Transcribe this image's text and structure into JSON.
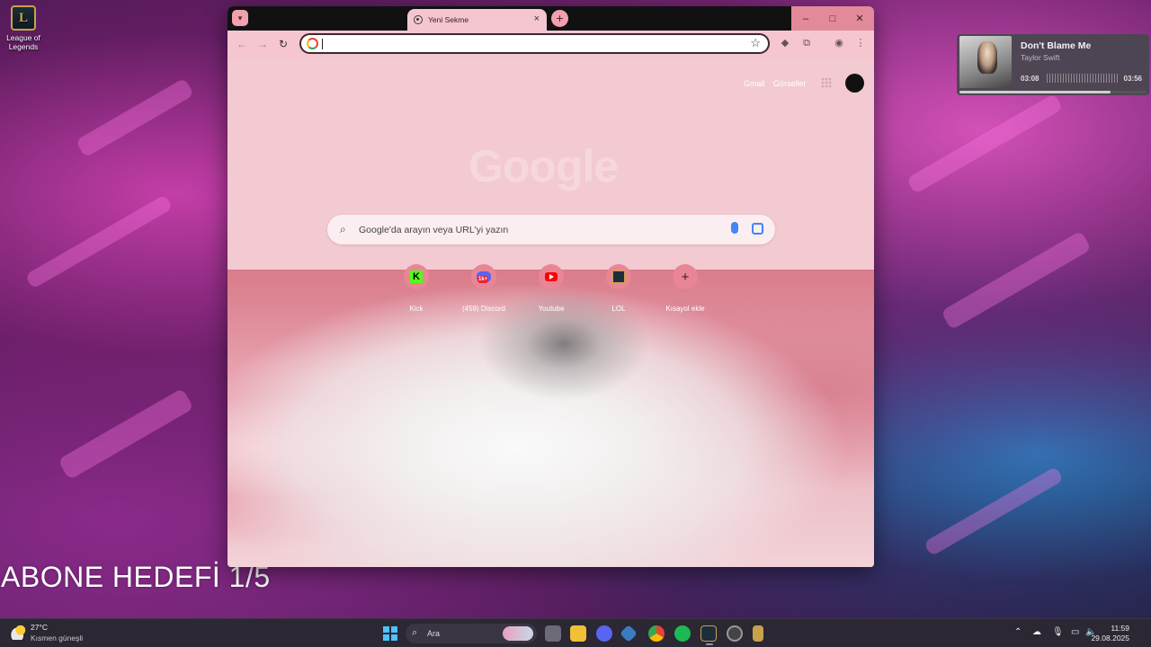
{
  "desktop": {
    "icon_label": "League of Legends",
    "overlay_text": "ABONE HEDEFİ 1/5"
  },
  "music_widget": {
    "title": "Don't Blame Me",
    "artist": "Taylor Swift",
    "elapsed": "03:08",
    "duration": "03:56",
    "progress_fraction": 0.81
  },
  "browser": {
    "tab_title": "Yeni Sekme",
    "tab_close": "×",
    "new_tab": "+",
    "window_controls": {
      "minimize": "–",
      "maximize": "□",
      "close": "✕"
    },
    "nav": {
      "back": "←",
      "forward": "→",
      "reload": "↻"
    },
    "omnibox_value": "",
    "bookmark_star": "☆",
    "top_links": {
      "gmail": "Gmail",
      "images": "Görseller"
    },
    "logo_text": "Google",
    "search_placeholder": "Google'da arayın veya URL'yi yazın",
    "shortcuts": [
      {
        "label": "Kick",
        "icon": "kick-icon"
      },
      {
        "label": "(459) Discord",
        "icon": "discord-icon"
      },
      {
        "label": "Youtube",
        "icon": "youtube-icon"
      },
      {
        "label": "LOL",
        "icon": "league-icon"
      },
      {
        "label": "Kısayol ekle",
        "icon": "plus-icon"
      }
    ],
    "accent_color": "#f4c9d0"
  },
  "taskbar": {
    "weather_temp": "27°C",
    "weather_desc": "Kısmen güneşli",
    "search_label": "Ara",
    "search_icon": "⌕",
    "tray_chevron": "⌃",
    "time": "11:59",
    "date": "29.08.2025"
  }
}
